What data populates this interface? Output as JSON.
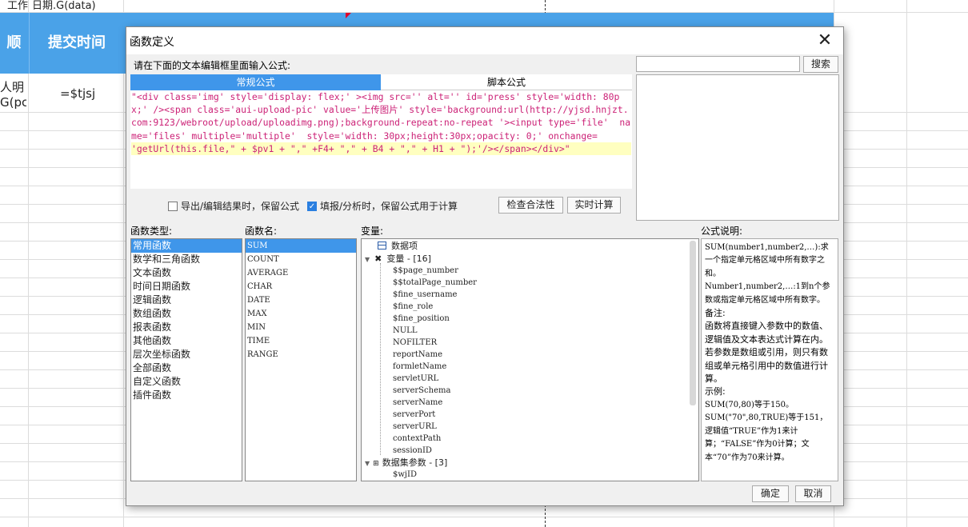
{
  "sheet": {
    "top_cells": [
      "工作",
      "日期.G(data)"
    ],
    "header": [
      "顺次",
      "提交时间"
    ],
    "row1": [
      "人明",
      "G(pc)",
      "=$tjsj"
    ]
  },
  "dialog": {
    "title": "函数定义",
    "prompt": "请在下面的文本编辑框里面输入公式:",
    "tabs": [
      "常规公式",
      "脚本公式"
    ],
    "formula_plain": "\"<div class='img' style='display: flex;' ><img src='' alt='' id='press' style='width: 80px;' /><span class='aui-upload-pic' value='上传图片' style='background:url(http://yjsd.hnjzt.com:9123/webroot/upload/uploadimg.png);background-repeat:no-repeat '><input type='file'  name='files' multiple='multiple'  style='width: 30px;height:30px;opacity: 0;' onchange=",
    "formula_hl": "'getUrl(this.file,\" + $pv1 + \",\" +F4+ \",\" + B4 + \",\" + H1 + \");'/></span></div>\"",
    "search_button": "搜索",
    "option1": "导出/编辑结果时，保留公式",
    "option2": "填报/分析时，保留公式用于计算",
    "check_button": "检查合法性",
    "realtime_button": "实时计算",
    "labels": {
      "func_type": "函数类型:",
      "func_name": "函数名:",
      "variables": "变量:",
      "description": "公式说明:"
    },
    "func_types": [
      "常用函数",
      "数学和三角函数",
      "文本函数",
      "时间日期函数",
      "逻辑函数",
      "数组函数",
      "报表函数",
      "其他函数",
      "层次坐标函数",
      "全部函数",
      "自定义函数",
      "插件函数"
    ],
    "func_names": [
      "SUM",
      "COUNT",
      "AVERAGE",
      "CHAR",
      "DATE",
      "MAX",
      "MIN",
      "TIME",
      "RANGE"
    ],
    "tree": {
      "data_item": "数据项",
      "vars_group": "变量 - [16]",
      "vars": [
        "$$page_number",
        "$$totalPage_number",
        "$fine_username",
        "$fine_role",
        "$fine_position",
        "NULL",
        "NOFILTER",
        "reportName",
        "formletName",
        "servletURL",
        "serverSchema",
        "serverName",
        "serverPort",
        "serverURL",
        "contextPath",
        "sessionID"
      ],
      "ds_group": "数据集参数 - [3]",
      "ds_vars": [
        "$wjID"
      ]
    },
    "description": [
      "SUM(number1,number2,…):求一个指定单元格区域中所有数字之和。",
      "Number1,number2,…:1到n个参数或指定单元格区域中所有数字。",
      "备注:",
      "函数将直接键入参数中的数值、逻辑值及文本表达式计算在内。若参数是数组或引用，则只有数组或单元格引用中的数值进行计算。",
      "示例:",
      "SUM(70,80)等于150。",
      "SUM(\"70\",80,TRUE)等于151，逻辑值“TRUE”作为1来计算；“FALSE”作为0计算；文本“70”作为70来计算。"
    ],
    "ok_button": "确定",
    "cancel_button": "取消"
  }
}
